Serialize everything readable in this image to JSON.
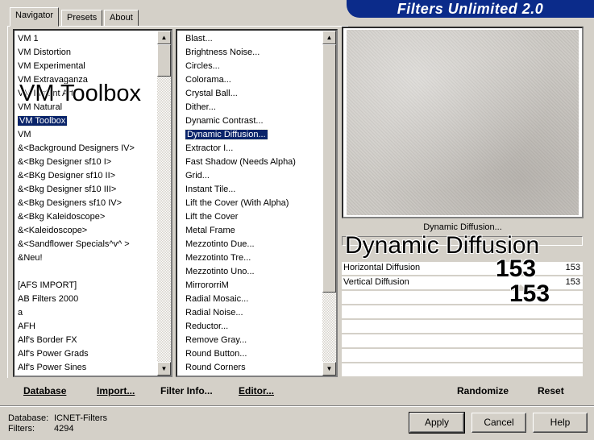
{
  "tabs": [
    {
      "label": "Navigator",
      "active": true
    },
    {
      "label": "Presets",
      "active": false
    },
    {
      "label": "About",
      "active": false
    }
  ],
  "brand_title": "Filters Unlimited 2.0",
  "categories": [
    {
      "label": "VM 1"
    },
    {
      "label": "VM Distortion"
    },
    {
      "label": "VM Experimental"
    },
    {
      "label": "VM Extravaganza"
    },
    {
      "label": "VM Instant Art"
    },
    {
      "label": "VM Natural"
    },
    {
      "label": "VM Toolbox",
      "selected": true
    },
    {
      "label": "VM"
    },
    {
      "label": "&<Background Designers IV>"
    },
    {
      "label": "&<Bkg Designer sf10 I>"
    },
    {
      "label": "&<BKg Designer sf10 II>"
    },
    {
      "label": "&<Bkg Designer sf10 III>"
    },
    {
      "label": "&<Bkg Designers sf10 IV>"
    },
    {
      "label": "&<Bkg Kaleidoscope>"
    },
    {
      "label": "&<Kaleidoscope>"
    },
    {
      "label": "&<Sandflower Specials^v^ >"
    },
    {
      "label": "&Neu!"
    },
    {
      "label": ""
    },
    {
      "label": "[AFS IMPORT]"
    },
    {
      "label": "AB Filters 2000"
    },
    {
      "label": "a"
    },
    {
      "label": "AFH"
    },
    {
      "label": "Alf's Border FX"
    },
    {
      "label": "Alf's Power Grads"
    },
    {
      "label": "Alf's Power Sines"
    }
  ],
  "filters": [
    {
      "label": "Blast..."
    },
    {
      "label": "Brightness Noise..."
    },
    {
      "label": "Circles..."
    },
    {
      "label": "Colorama..."
    },
    {
      "label": "Crystal Ball..."
    },
    {
      "label": "Dither..."
    },
    {
      "label": "Dynamic Contrast..."
    },
    {
      "label": "Dynamic Diffusion...",
      "selected": true
    },
    {
      "label": "Extractor I..."
    },
    {
      "label": "Fast Shadow (Needs Alpha)"
    },
    {
      "label": "Grid..."
    },
    {
      "label": "Instant Tile..."
    },
    {
      "label": "Lift the Cover (With Alpha)"
    },
    {
      "label": "Lift the Cover"
    },
    {
      "label": "Metal Frame"
    },
    {
      "label": "Mezzotinto Due..."
    },
    {
      "label": "Mezzotinto Tre..."
    },
    {
      "label": "Mezzotinto Uno..."
    },
    {
      "label": "MirrororriM"
    },
    {
      "label": "Radial Mosaic..."
    },
    {
      "label": "Radial Noise..."
    },
    {
      "label": "Reductor..."
    },
    {
      "label": "Remove Gray..."
    },
    {
      "label": "Round Button..."
    },
    {
      "label": "Round Corners"
    }
  ],
  "overlay": {
    "category": "VM Toolbox",
    "filter": "Dynamic Diffusion",
    "value1": "153",
    "value2": "153"
  },
  "preview": {
    "caption": "Dynamic Diffusion..."
  },
  "params": [
    {
      "label": "Horizontal Diffusion",
      "value": "153",
      "level": 153,
      "max": 255
    },
    {
      "label": "Vertical Diffusion",
      "value": "153",
      "level": 153,
      "max": 255
    }
  ],
  "actions": {
    "database": "Database",
    "import": "Import...",
    "filter_info": "Filter Info...",
    "editor": "Editor...",
    "randomize": "Randomize",
    "reset": "Reset"
  },
  "status": {
    "database_label": "Database:",
    "database_value": "ICNET-Filters",
    "filters_label": "Filters:",
    "filters_value": "4294"
  },
  "buttons": {
    "apply": "Apply",
    "cancel": "Cancel",
    "help": "Help"
  }
}
